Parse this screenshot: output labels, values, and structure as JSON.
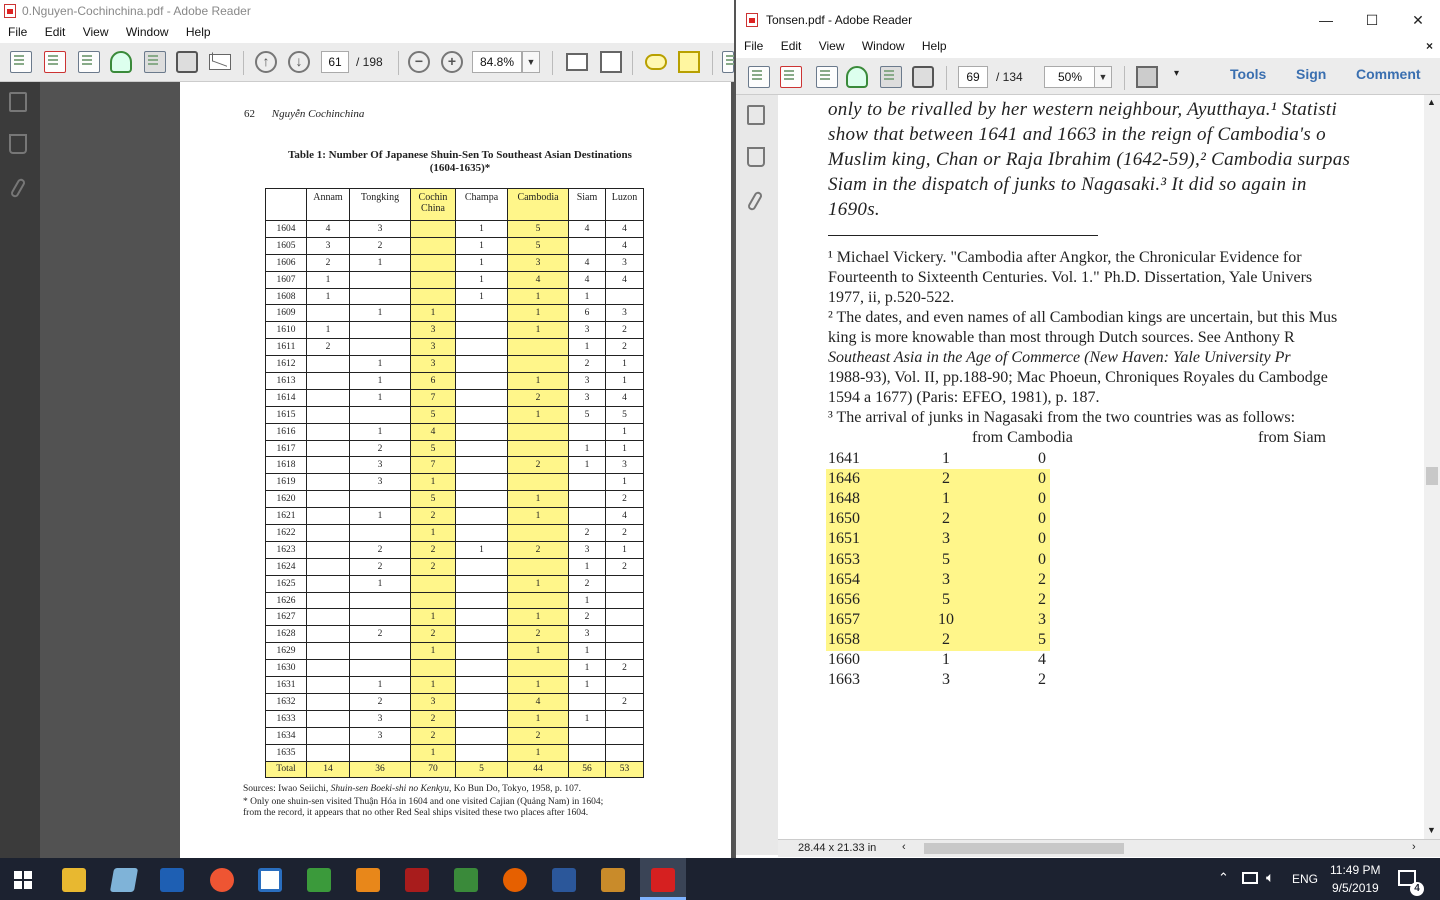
{
  "left_window": {
    "title": "0.Nguyen-Cochinchina.pdf - Adobe Reader",
    "menu": [
      "File",
      "Edit",
      "View",
      "Window",
      "Help"
    ],
    "page_current": "61",
    "page_total": "/ 198",
    "zoom": "84.8%",
    "page": {
      "page_number": "62",
      "running_title": "Nguyễn Cochinchina",
      "table_caption_line1": "Table 1: Number Of Japanese Shuin-Sen To Southeast Asian Destinations",
      "table_caption_line2": "(1604-1635)*",
      "table_headers": [
        "",
        "Annam",
        "Tongking",
        "Cochin China",
        "Champa",
        "Cambodia",
        "Siam",
        "Luzon"
      ],
      "table_rows": [
        [
          "1604",
          "4",
          "3",
          "",
          "1",
          "5",
          "4",
          "4"
        ],
        [
          "1605",
          "3",
          "2",
          "",
          "1",
          "5",
          "",
          "4"
        ],
        [
          "1606",
          "2",
          "1",
          "",
          "1",
          "3",
          "4",
          "3"
        ],
        [
          "1607",
          "1",
          "",
          "",
          "1",
          "4",
          "4",
          "4"
        ],
        [
          "1608",
          "1",
          "",
          "",
          "1",
          "1",
          "1",
          ""
        ],
        [
          "1609",
          "",
          "1",
          "1",
          "",
          "1",
          "6",
          "3"
        ],
        [
          "1610",
          "1",
          "",
          "3",
          "",
          "1",
          "3",
          "2"
        ],
        [
          "1611",
          "2",
          "",
          "3",
          "",
          "",
          "1",
          "2"
        ],
        [
          "1612",
          "",
          "1",
          "3",
          "",
          "",
          "2",
          "1"
        ],
        [
          "1613",
          "",
          "1",
          "6",
          "",
          "1",
          "3",
          "1"
        ],
        [
          "1614",
          "",
          "1",
          "7",
          "",
          "2",
          "3",
          "4"
        ],
        [
          "1615",
          "",
          "",
          "5",
          "",
          "1",
          "5",
          "5"
        ],
        [
          "1616",
          "",
          "1",
          "4",
          "",
          "",
          "",
          "1"
        ],
        [
          "1617",
          "",
          "2",
          "5",
          "",
          "",
          "1",
          "1"
        ],
        [
          "1618",
          "",
          "3",
          "7",
          "",
          "2",
          "1",
          "3"
        ],
        [
          "1619",
          "",
          "3",
          "1",
          "",
          "",
          "",
          "1"
        ],
        [
          "1620",
          "",
          "",
          "5",
          "",
          "1",
          "",
          "2"
        ],
        [
          "1621",
          "",
          "1",
          "2",
          "",
          "1",
          "",
          "4"
        ],
        [
          "1622",
          "",
          "",
          "1",
          "",
          "",
          "2",
          "2"
        ],
        [
          "1623",
          "",
          "2",
          "2",
          "1",
          "2",
          "3",
          "1"
        ],
        [
          "1624",
          "",
          "2",
          "2",
          "",
          "",
          "1",
          "2"
        ],
        [
          "1625",
          "",
          "1",
          "",
          "",
          "1",
          "2",
          ""
        ],
        [
          "1626",
          "",
          "",
          "",
          "",
          "",
          "1",
          ""
        ],
        [
          "1627",
          "",
          "",
          "1",
          "",
          "1",
          "2",
          ""
        ],
        [
          "1628",
          "",
          "2",
          "2",
          "",
          "2",
          "3",
          ""
        ],
        [
          "1629",
          "",
          "",
          "1",
          "",
          "1",
          "1",
          ""
        ],
        [
          "1630",
          "",
          "",
          "",
          "",
          "",
          "1",
          "2"
        ],
        [
          "1631",
          "",
          "1",
          "1",
          "",
          "1",
          "1",
          ""
        ],
        [
          "1632",
          "",
          "2",
          "3",
          "",
          "4",
          "",
          "2"
        ],
        [
          "1633",
          "",
          "3",
          "2",
          "",
          "1",
          "1",
          ""
        ],
        [
          "1634",
          "",
          "3",
          "2",
          "",
          "2",
          "",
          ""
        ],
        [
          "1635",
          "",
          "",
          "1",
          "",
          "1",
          "",
          ""
        ]
      ],
      "table_total": [
        "Total",
        "14",
        "36",
        "70",
        "5",
        "44",
        "56",
        "53"
      ],
      "sources_prefix": "Sources: Iwao Seiichi, ",
      "sources_title": "Shuin-sen Boeki-shi no Kenkyu",
      "sources_suffix": ", Ko Bun Do, Tokyo, 1958, p. 107.",
      "note_line1": "* Only one shuin-sen visited Thuận Hóa in 1604 and one visited Cajian (Quảng Nam) in 1604;",
      "note_line2": "from the record, it appears that no other Red Seal ships visited these two places after 1604."
    }
  },
  "right_window": {
    "title": "Tonsen.pdf - Adobe Reader",
    "menu": [
      "File",
      "Edit",
      "View",
      "Window",
      "Help"
    ],
    "page_current": "69",
    "page_total": "/ 134",
    "zoom": "50%",
    "links": {
      "tools": "Tools",
      "sign": "Sign",
      "comment": "Comment"
    },
    "status_size": "28.44 x 21.33 in",
    "body_lines": [
      "only to be rivalled by her western neighbour, Ayutthaya.¹  Statisti",
      "show that between 1641 and 1663 in the reign of Cambodia's o",
      "Muslim king, Chan or Raja Ibrahim (1642-59),²  Cambodia surpas",
      "Siam in the dispatch of junks to Nagasaki.³  It did so again in",
      "1690s."
    ],
    "footnotes": [
      "¹ Michael Vickery. \"Cambodia after Angkor, the Chronicular Evidence for",
      "Fourteenth to Sixteenth Centuries. Vol. 1.\" Ph.D. Dissertation, Yale Univers",
      "1977, ii, p.520-522.",
      "² The dates, and even names of all Cambodian kings are uncertain, but this Mus",
      "king is more knowable than most through Dutch sources.  See Anthony R",
      "Southeast Asia in the Age of Commerce (New Haven: Yale University Pr",
      "1988-93), Vol. II, pp.188-90; Mac Phoeun, Chroniques Royales du Cambodge",
      "1594 a 1677) (Paris: EFEO, 1981), p. 187.",
      "³  The arrival of junks in Nagasaki from the two countries was as follows:"
    ],
    "junk_headers": {
      "cambodia": "from Cambodia",
      "siam": "from Siam"
    },
    "junk_rows": [
      {
        "year": "1641",
        "cambodia": "1",
        "siam": "0"
      },
      {
        "year": "1646",
        "cambodia": "2",
        "siam": "0"
      },
      {
        "year": "1648",
        "cambodia": "1",
        "siam": "0"
      },
      {
        "year": "1650",
        "cambodia": "2",
        "siam": "0"
      },
      {
        "year": "1651",
        "cambodia": "3",
        "siam": "0"
      },
      {
        "year": "1653",
        "cambodia": "5",
        "siam": "0"
      },
      {
        "year": "1654",
        "cambodia": "3",
        "siam": "2"
      },
      {
        "year": "1656",
        "cambodia": "5",
        "siam": "2"
      },
      {
        "year": "1657",
        "cambodia": "10",
        "siam": "3"
      },
      {
        "year": "1658",
        "cambodia": "2",
        "siam": "5"
      },
      {
        "year": "1660",
        "cambodia": "1",
        "siam": "4"
      },
      {
        "year": "1663",
        "cambodia": "3",
        "siam": "2"
      }
    ]
  },
  "taskbar": {
    "lang": "ENG",
    "time": "11:49 PM",
    "date": "9/5/2019",
    "notifications": "4"
  }
}
